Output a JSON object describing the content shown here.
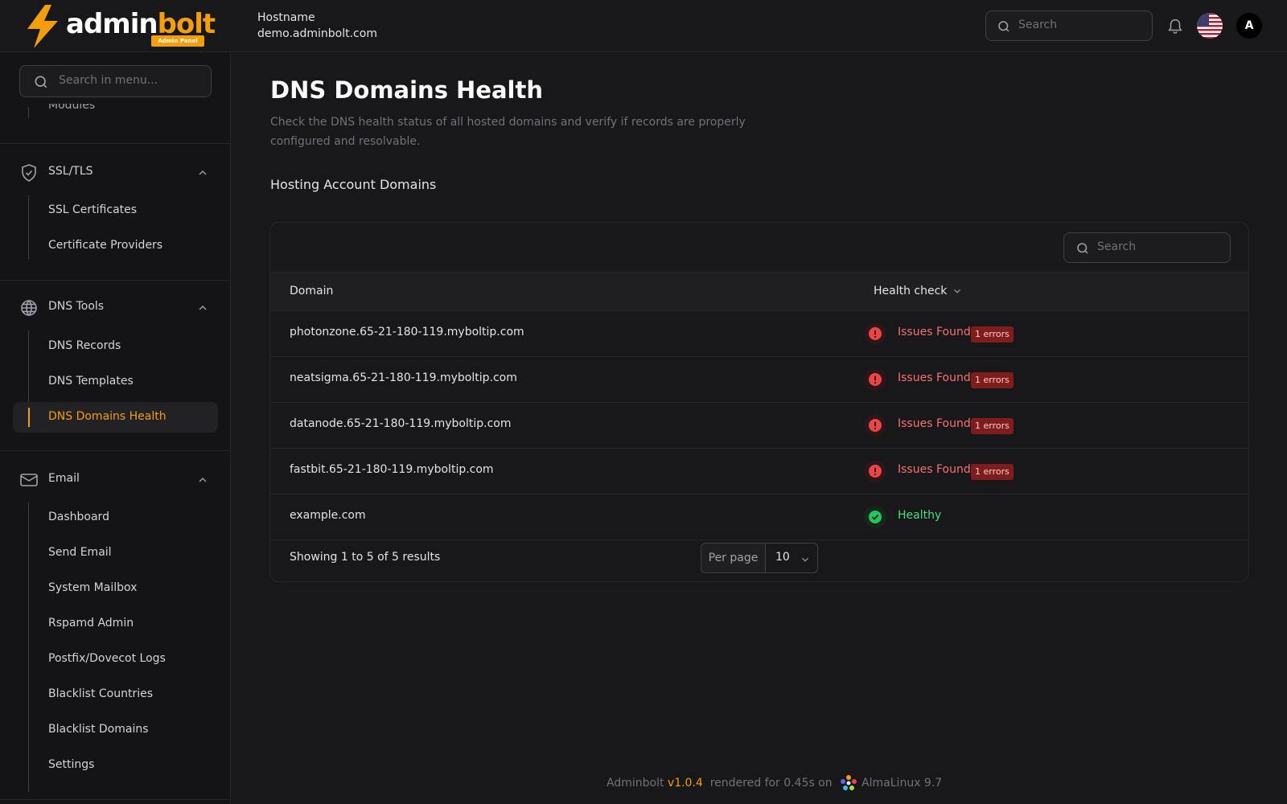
{
  "header": {
    "brand_part1": "admin",
    "brand_part2": "bolt",
    "brand_badge": "Admin Panel",
    "hostname_label": "Hostname",
    "hostname_value": "demo.adminbolt.com",
    "search_placeholder": "Search",
    "avatar_initial": "A",
    "icons": [
      "lightning-bolt-icon",
      "search-icon",
      "bell-icon",
      "us-flag-icon"
    ]
  },
  "sidebar": {
    "search_placeholder": "Search in menu...",
    "clipped_item": "Modules",
    "groups": [
      {
        "label": "SSL/TLS",
        "icon": "shield-check-icon",
        "items": [
          {
            "label": "SSL Certificates"
          },
          {
            "label": "Certificate Providers"
          }
        ]
      },
      {
        "label": "DNS Tools",
        "icon": "globe-icon",
        "items": [
          {
            "label": "DNS Records"
          },
          {
            "label": "DNS Templates"
          },
          {
            "label": "DNS Domains Health",
            "active": true
          }
        ]
      },
      {
        "label": "Email",
        "icon": "envelope-icon",
        "items": [
          {
            "label": "Dashboard"
          },
          {
            "label": "Send Email"
          },
          {
            "label": "System Mailbox"
          },
          {
            "label": "Rspamd Admin"
          },
          {
            "label": "Postfix/Dovecot Logs"
          },
          {
            "label": "Blacklist Countries"
          },
          {
            "label": "Blacklist Domains"
          },
          {
            "label": "Settings"
          }
        ]
      }
    ]
  },
  "main": {
    "title": "DNS Domains Health",
    "subtitle": "Check the DNS health status of all hosted domains and verify if records are properly configured and resolvable.",
    "section_title": "Hosting Account Domains",
    "table": {
      "search_placeholder": "Search",
      "columns": [
        "Domain",
        "Health check"
      ],
      "rows": [
        {
          "domain": "photonzone.65-21-180-119.myboltip.com",
          "status": "Issues Found",
          "badge": "1 errors",
          "state": "error"
        },
        {
          "domain": "neatsigma.65-21-180-119.myboltip.com",
          "status": "Issues Found",
          "badge": "1 errors",
          "state": "error"
        },
        {
          "domain": "datanode.65-21-180-119.myboltip.com",
          "status": "Issues Found",
          "badge": "1 errors",
          "state": "error"
        },
        {
          "domain": "fastbit.65-21-180-119.myboltip.com",
          "status": "Issues Found",
          "badge": "1 errors",
          "state": "error"
        },
        {
          "domain": "example.com",
          "status": "Healthy",
          "badge": "",
          "state": "ok"
        }
      ],
      "results_text": "Showing 1 to 5 of 5 results",
      "per_page_label": "Per page",
      "per_page_value": "10"
    }
  },
  "footer": {
    "app": "Adminbolt",
    "version": "v1.0.4",
    "rendered": "rendered for 0.45s on",
    "os": "AlmaLinux 9.7"
  },
  "colors": {
    "accent": "#f59e0b",
    "error": "#f87171",
    "success": "#4ade80",
    "background": "#18181b"
  }
}
